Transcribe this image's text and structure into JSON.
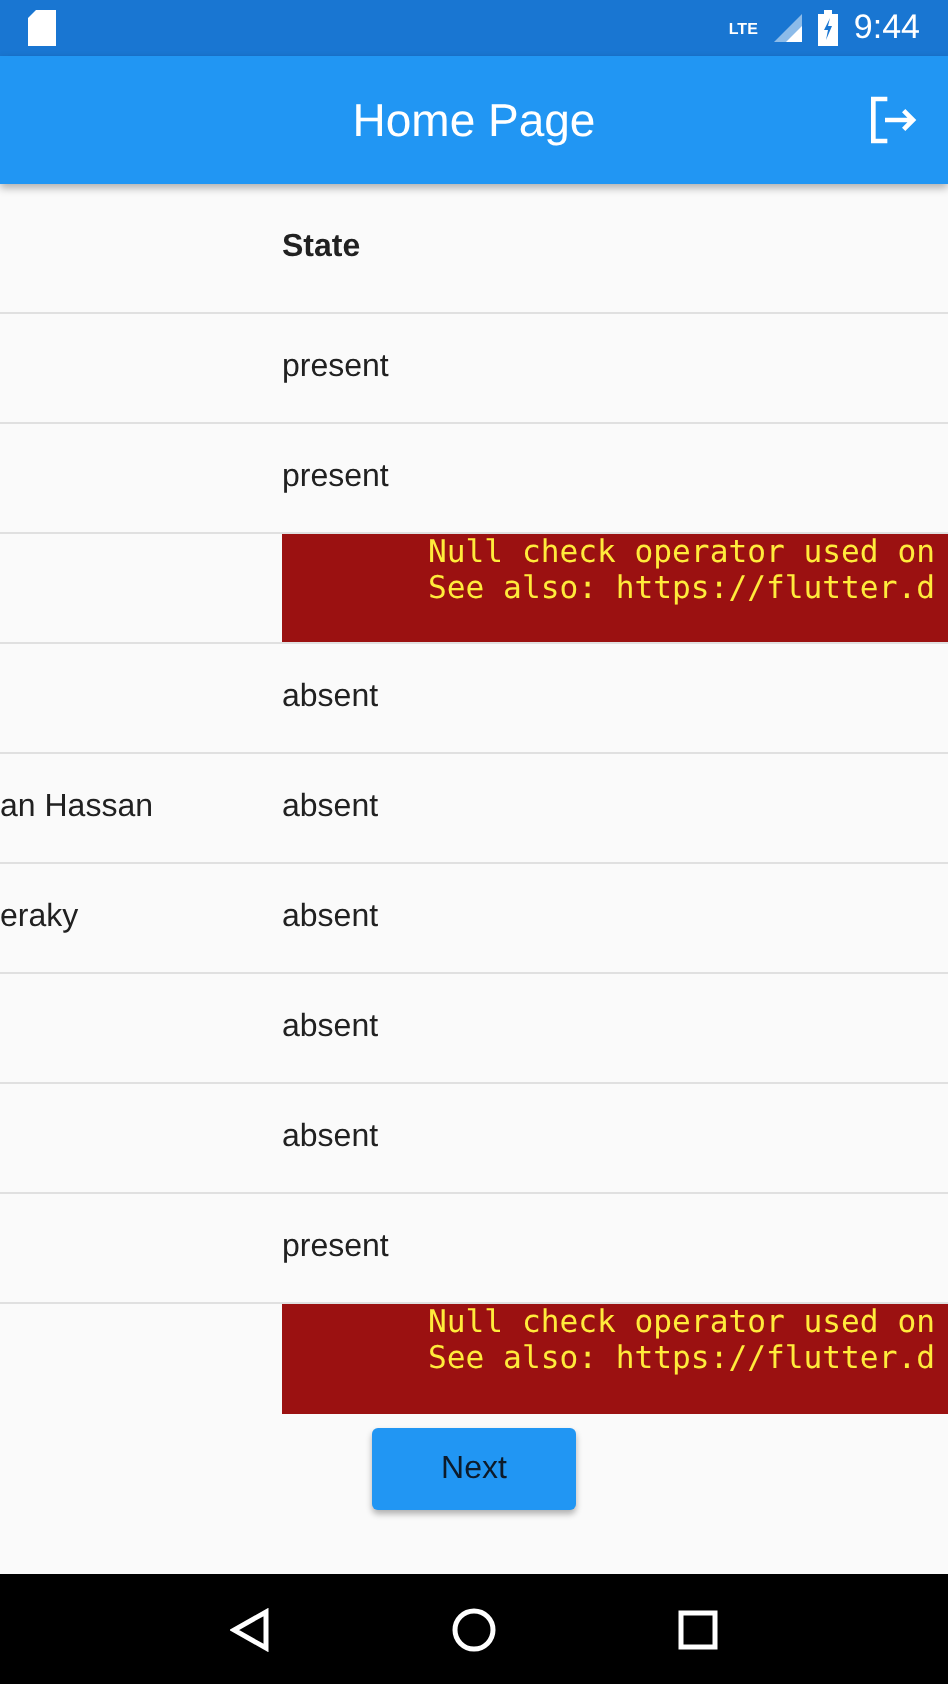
{
  "status_bar": {
    "network": "LTE",
    "time": "9:44"
  },
  "app_bar": {
    "title": "Home Page"
  },
  "table": {
    "columns": [
      "",
      "State"
    ],
    "rows": [
      {
        "kind": "state",
        "name": "",
        "state": "present"
      },
      {
        "kind": "state",
        "name": "",
        "state": "present"
      },
      {
        "kind": "error",
        "lines": [
          "Null check operator used on",
          "See also: https://flutter.d"
        ]
      },
      {
        "kind": "state",
        "name": "",
        "state": "absent"
      },
      {
        "kind": "state",
        "name": "an Hassan",
        "state": "absent"
      },
      {
        "kind": "state",
        "name": "eraky",
        "state": "absent"
      },
      {
        "kind": "state",
        "name": "",
        "state": "absent"
      },
      {
        "kind": "state",
        "name": "",
        "state": "absent"
      },
      {
        "kind": "state",
        "name": "",
        "state": "present"
      },
      {
        "kind": "error",
        "lines": [
          "Null check operator used on",
          "See also: https://flutter.d"
        ]
      }
    ]
  },
  "next_button": {
    "label": "Next"
  }
}
